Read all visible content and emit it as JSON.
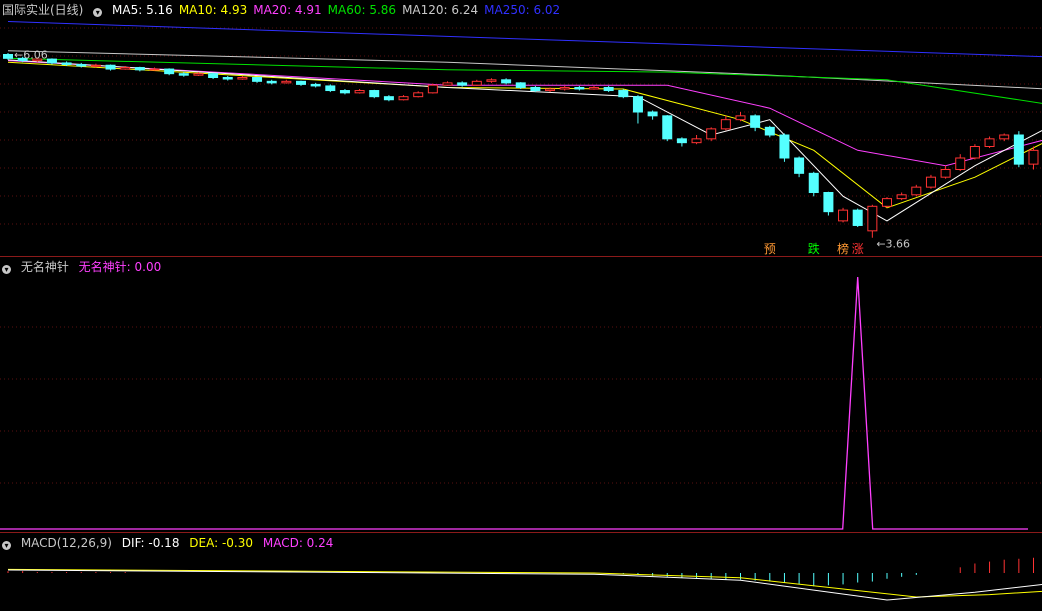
{
  "main": {
    "title": "国际实业(日线)",
    "ma": [
      {
        "label": "MA5: 5.16",
        "color": "#ffffff"
      },
      {
        "label": "MA10: 4.93",
        "color": "#ffff00"
      },
      {
        "label": "MA20: 4.91",
        "color": "#ff40ff"
      },
      {
        "label": "MA60: 5.86",
        "color": "#00e000"
      },
      {
        "label": "MA120: 6.24",
        "color": "#c8c8c8"
      },
      {
        "label": "MA250: 6.02",
        "color": "#3030ff"
      }
    ],
    "high_label": "6.06",
    "low_label": "3.66",
    "signals": [
      {
        "text": "预",
        "bar": 52,
        "color": "#ff9933"
      },
      {
        "text": "跌",
        "bar": 55,
        "color": "#00ff00"
      },
      {
        "text": "榜",
        "bar": 57,
        "color": "#ff9933"
      },
      {
        "text": "涨",
        "bar": 58,
        "color": "#ff3333"
      }
    ]
  },
  "indicator": {
    "name": "无名神针",
    "value_label": "无名神针: 0.00",
    "value_color": "#ff40ff"
  },
  "macd": {
    "name": "MACD(12,26,9)",
    "dif_label": "DIF: -0.18",
    "dea_label": "DEA: -0.30",
    "macd_label": "MACD: 0.24",
    "dif_color": "#ffffff",
    "dea_color": "#ffff00",
    "macd_color": "#ff40ff"
  },
  "chart_data": {
    "type": "candlestick",
    "price_range": [
      3.5,
      6.5
    ],
    "candles": [
      [
        6.05,
        6.0,
        6.07,
        5.98
      ],
      [
        6.0,
        5.97,
        6.02,
        5.95
      ],
      [
        5.97,
        5.99,
        6.01,
        5.95
      ],
      [
        5.99,
        5.94,
        6.0,
        5.92
      ],
      [
        5.94,
        5.92,
        5.96,
        5.9
      ],
      [
        5.92,
        5.9,
        5.94,
        5.88
      ],
      [
        5.9,
        5.91,
        5.93,
        5.88
      ],
      [
        5.91,
        5.86,
        5.92,
        5.84
      ],
      [
        5.86,
        5.88,
        5.9,
        5.85
      ],
      [
        5.88,
        5.85,
        5.89,
        5.83
      ],
      [
        5.85,
        5.86,
        5.88,
        5.84
      ],
      [
        5.86,
        5.8,
        5.87,
        5.78
      ],
      [
        5.8,
        5.78,
        5.82,
        5.76
      ],
      [
        5.78,
        5.8,
        5.82,
        5.77
      ],
      [
        5.8,
        5.75,
        5.81,
        5.73
      ],
      [
        5.75,
        5.73,
        5.77,
        5.71
      ],
      [
        5.73,
        5.75,
        5.77,
        5.72
      ],
      [
        5.75,
        5.7,
        5.76,
        5.68
      ],
      [
        5.7,
        5.68,
        5.72,
        5.66
      ],
      [
        5.68,
        5.7,
        5.72,
        5.67
      ],
      [
        5.7,
        5.66,
        5.71,
        5.64
      ],
      [
        5.66,
        5.64,
        5.68,
        5.62
      ],
      [
        5.64,
        5.58,
        5.66,
        5.56
      ],
      [
        5.58,
        5.55,
        5.6,
        5.53
      ],
      [
        5.55,
        5.58,
        5.6,
        5.54
      ],
      [
        5.58,
        5.5,
        5.59,
        5.48
      ],
      [
        5.5,
        5.46,
        5.52,
        5.44
      ],
      [
        5.46,
        5.5,
        5.52,
        5.45
      ],
      [
        5.5,
        5.55,
        5.57,
        5.49
      ],
      [
        5.55,
        5.65,
        5.67,
        5.54
      ],
      [
        5.65,
        5.68,
        5.7,
        5.64
      ],
      [
        5.68,
        5.65,
        5.7,
        5.63
      ],
      [
        5.65,
        5.7,
        5.72,
        5.64
      ],
      [
        5.7,
        5.72,
        5.74,
        5.68
      ],
      [
        5.72,
        5.68,
        5.74,
        5.66
      ],
      [
        5.68,
        5.62,
        5.69,
        5.6
      ],
      [
        5.62,
        5.58,
        5.64,
        5.56
      ],
      [
        5.58,
        5.6,
        5.62,
        5.56
      ],
      [
        5.6,
        5.62,
        5.64,
        5.58
      ],
      [
        5.62,
        5.6,
        5.64,
        5.58
      ],
      [
        5.6,
        5.62,
        5.64,
        5.59
      ],
      [
        5.62,
        5.58,
        5.64,
        5.56
      ],
      [
        5.58,
        5.5,
        5.6,
        5.48
      ],
      [
        5.5,
        5.3,
        5.52,
        5.15
      ],
      [
        5.3,
        5.25,
        5.32,
        5.2
      ],
      [
        5.25,
        4.95,
        5.26,
        4.92
      ],
      [
        4.95,
        4.9,
        4.97,
        4.85
      ],
      [
        4.9,
        4.95,
        5.0,
        4.88
      ],
      [
        4.95,
        5.08,
        5.1,
        4.92
      ],
      [
        5.08,
        5.2,
        5.25,
        5.06
      ],
      [
        5.2,
        5.25,
        5.3,
        5.18
      ],
      [
        5.25,
        5.1,
        5.27,
        5.05
      ],
      [
        5.1,
        5.0,
        5.12,
        4.97
      ],
      [
        5.0,
        4.7,
        5.02,
        4.65
      ],
      [
        4.7,
        4.5,
        4.72,
        4.45
      ],
      [
        4.5,
        4.25,
        4.52,
        4.2
      ],
      [
        4.25,
        4.0,
        4.26,
        3.95
      ],
      [
        3.88,
        4.02,
        4.05,
        3.86
      ],
      [
        4.02,
        3.82,
        4.04,
        3.8
      ],
      [
        3.75,
        4.07,
        4.09,
        3.66
      ],
      [
        4.07,
        4.17,
        4.19,
        4.05
      ],
      [
        4.17,
        4.22,
        4.25,
        4.15
      ],
      [
        4.22,
        4.32,
        4.35,
        4.2
      ],
      [
        4.32,
        4.45,
        4.48,
        4.3
      ],
      [
        4.45,
        4.55,
        4.6,
        4.43
      ],
      [
        4.55,
        4.7,
        4.75,
        4.53
      ],
      [
        4.7,
        4.85,
        4.88,
        4.68
      ],
      [
        4.85,
        4.95,
        4.98,
        4.83
      ],
      [
        4.95,
        5.0,
        5.02,
        4.92
      ],
      [
        5.0,
        4.62,
        5.05,
        4.58
      ],
      [
        4.62,
        4.8,
        4.85,
        4.55
      ],
      [
        4.8,
        4.88,
        4.9,
        4.78
      ]
    ],
    "ma_lines": {
      "MA250": [
        [
          0,
          6.48
        ],
        [
          71,
          6.02
        ]
      ],
      "MA120": [
        [
          0,
          6.1
        ],
        [
          30,
          5.95
        ],
        [
          50,
          5.8
        ],
        [
          71,
          5.6
        ]
      ],
      "MA60": [
        [
          0,
          6.0
        ],
        [
          30,
          5.85
        ],
        [
          45,
          5.82
        ],
        [
          60,
          5.72
        ],
        [
          71,
          5.4
        ]
      ],
      "MA20": [
        [
          0,
          5.97
        ],
        [
          30,
          5.65
        ],
        [
          45,
          5.65
        ],
        [
          52,
          5.35
        ],
        [
          58,
          4.8
        ],
        [
          64,
          4.6
        ],
        [
          71,
          4.95
        ]
      ],
      "MA10": [
        [
          0,
          5.95
        ],
        [
          30,
          5.62
        ],
        [
          42,
          5.6
        ],
        [
          50,
          5.2
        ],
        [
          55,
          4.8
        ],
        [
          60,
          4.05
        ],
        [
          66,
          4.45
        ],
        [
          71,
          4.93
        ]
      ],
      "MA5": [
        [
          0,
          5.98
        ],
        [
          30,
          5.62
        ],
        [
          43,
          5.5
        ],
        [
          48,
          5.0
        ],
        [
          52,
          5.2
        ],
        [
          57,
          4.2
        ],
        [
          60,
          3.88
        ],
        [
          66,
          4.6
        ],
        [
          71,
          5.1
        ]
      ]
    },
    "spike": {
      "bar": 58,
      "peak": 1.0,
      "base": 0.0
    },
    "macd_hist": [
      0.02,
      0.02,
      0.01,
      0.01,
      0.01,
      0.01,
      0.01,
      0.01,
      0.01,
      0.0,
      0.0,
      0.0,
      0.0,
      0.0,
      0.0,
      0.0,
      0.0,
      0.0,
      0.0,
      0.0,
      0.0,
      0.0,
      0.0,
      0.0,
      0.0,
      0.0,
      0.0,
      0.0,
      0.0,
      0.0,
      0.0,
      0.0,
      0.0,
      0.0,
      0.0,
      0.0,
      0.0,
      0.0,
      0.0,
      0.0,
      0.0,
      0.0,
      -0.01,
      -0.02,
      -0.03,
      -0.04,
      -0.05,
      -0.06,
      -0.06,
      -0.07,
      -0.07,
      -0.08,
      -0.09,
      -0.1,
      -0.12,
      -0.14,
      -0.13,
      -0.12,
      -0.1,
      -0.09,
      -0.06,
      -0.04,
      -0.02,
      0.0,
      0.0,
      0.06,
      0.1,
      0.12,
      0.14,
      0.15,
      0.16,
      0.17
    ],
    "dif": [
      [
        0,
        0.05
      ],
      [
        40,
        -0.02
      ],
      [
        50,
        -0.12
      ],
      [
        60,
        -0.45
      ],
      [
        66,
        -0.32
      ],
      [
        71,
        -0.18
      ]
    ],
    "dea": [
      [
        0,
        0.06
      ],
      [
        40,
        0.0
      ],
      [
        50,
        -0.08
      ],
      [
        62,
        -0.4
      ],
      [
        67,
        -0.36
      ],
      [
        71,
        -0.3
      ]
    ]
  }
}
